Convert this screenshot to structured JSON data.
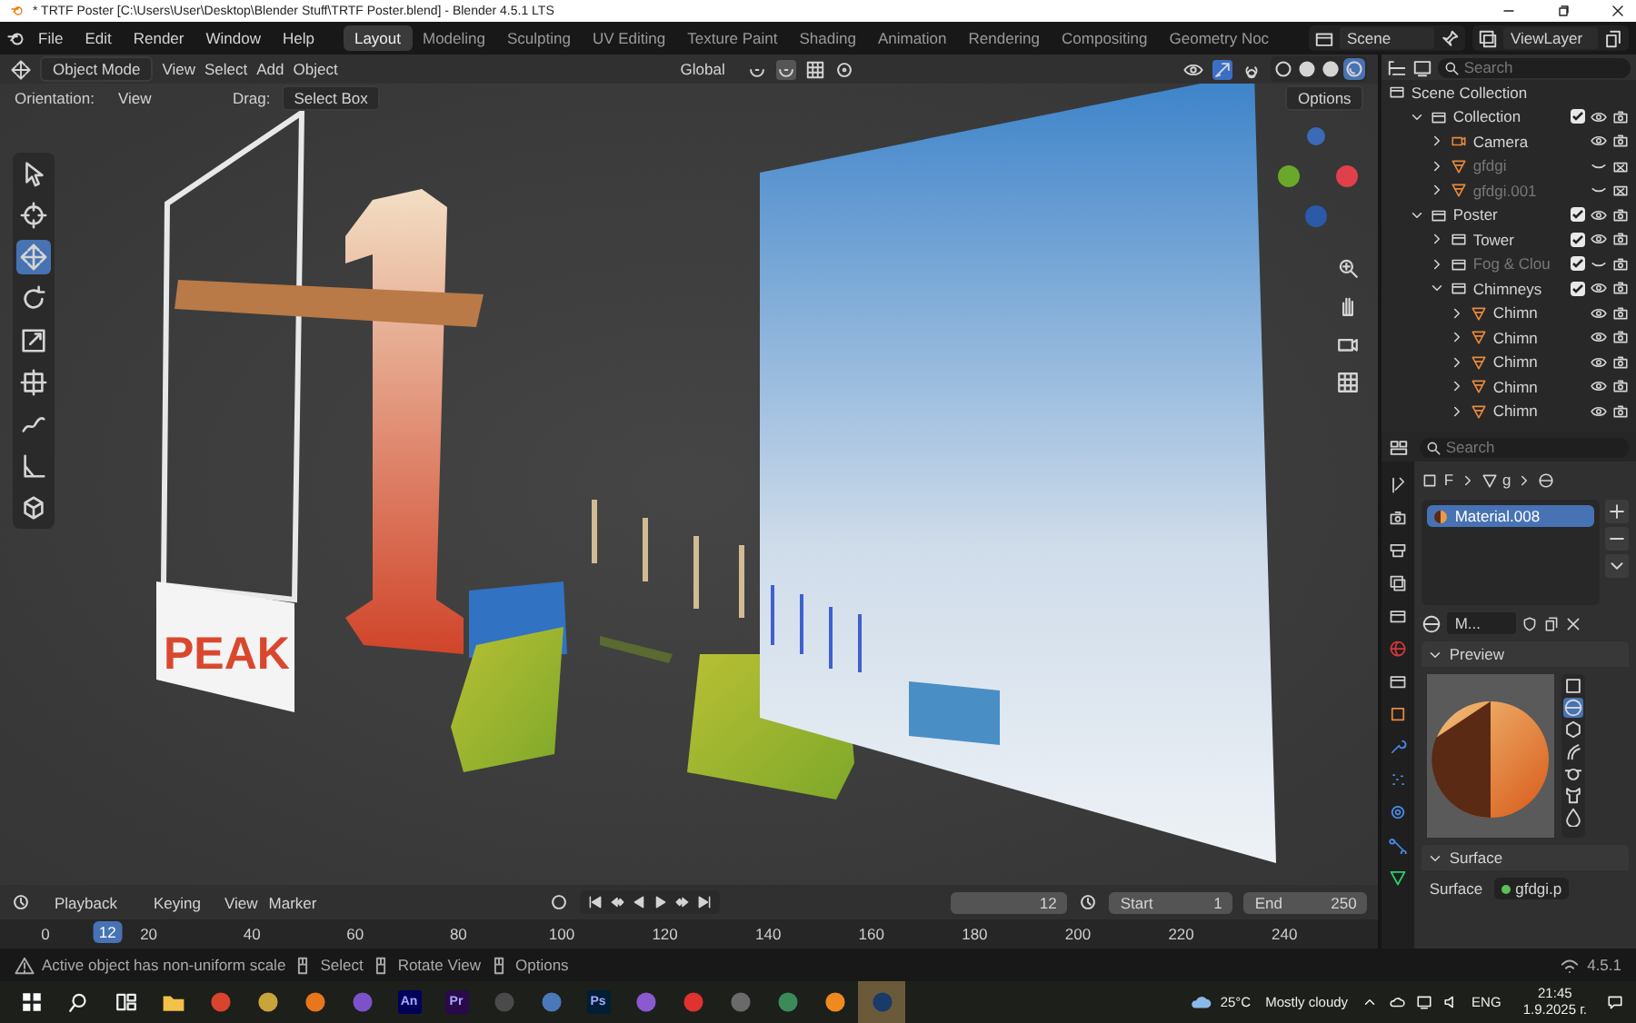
{
  "window": {
    "title": "* TRTF Poster [C:\\Users\\User\\Desktop\\Blender Stuff\\TRTF Poster.blend] - Blender 4.5.1 LTS"
  },
  "menu": [
    "File",
    "Edit",
    "Render",
    "Window",
    "Help"
  ],
  "workspaces": [
    {
      "label": "Layout",
      "selected": true
    },
    {
      "label": "Modeling",
      "selected": false
    },
    {
      "label": "Sculpting",
      "selected": false
    },
    {
      "label": "UV Editing",
      "selected": false
    },
    {
      "label": "Texture Paint",
      "selected": false
    },
    {
      "label": "Shading",
      "selected": false
    },
    {
      "label": "Animation",
      "selected": false
    },
    {
      "label": "Rendering",
      "selected": false
    },
    {
      "label": "Compositing",
      "selected": false
    },
    {
      "label": "Geometry Noc",
      "selected": false
    }
  ],
  "scene": {
    "name": "Scene"
  },
  "view_layer": {
    "name": "ViewLayer"
  },
  "viewport_header": {
    "mode": "Object Mode",
    "menus": [
      "View",
      "Select",
      "Add",
      "Object"
    ],
    "orientation": "Global",
    "shading": [
      {
        "kind": "wireframe",
        "selected": false
      },
      {
        "kind": "solid",
        "selected": false
      },
      {
        "kind": "material",
        "selected": false
      },
      {
        "kind": "rendered",
        "selected": true
      }
    ]
  },
  "tool_settings": {
    "orientation_label": "Orientation:",
    "orientation": "View",
    "drag_label": "Drag:",
    "drag": "Select Box",
    "options": "Options"
  },
  "tools": [
    {
      "kind": "select",
      "selected": false
    },
    {
      "kind": "cursor",
      "selected": false
    },
    {
      "kind": "move",
      "selected": true
    },
    {
      "kind": "rotate",
      "selected": false
    },
    {
      "kind": "scale",
      "selected": false
    },
    {
      "kind": "transform",
      "selected": false
    },
    {
      "kind": "annotate",
      "selected": false
    },
    {
      "kind": "measure",
      "selected": false
    },
    {
      "kind": "add-cube",
      "selected": false
    }
  ],
  "scene_view": {
    "poster_text": "PEAK"
  },
  "outliner": {
    "search_placeholder": "Search",
    "tree": {
      "name": "Scene Collection",
      "kind": "scene",
      "children": [
        {
          "name": "Collection",
          "kind": "collection",
          "expanded": true,
          "checked": true,
          "visible": true,
          "renderable": true,
          "disabled": false,
          "children": [
            {
              "name": "Camera",
              "kind": "camera",
              "expanded": false,
              "visible": true,
              "renderable": true,
              "disabled": false
            },
            {
              "name": "gfdgi",
              "kind": "mesh",
              "expanded": false,
              "visible": false,
              "renderable": false,
              "disabled": true
            },
            {
              "name": "gfdgi.001",
              "kind": "mesh",
              "expanded": false,
              "visible": false,
              "renderable": false,
              "disabled": true
            }
          ]
        },
        {
          "name": "Poster",
          "kind": "collection",
          "expanded": true,
          "checked": true,
          "visible": true,
          "renderable": true,
          "disabled": false,
          "children": [
            {
              "name": "Tower",
              "kind": "collection",
              "expanded": false,
              "checked": true,
              "visible": true,
              "renderable": true,
              "disabled": false
            },
            {
              "name": "Fog & Clou",
              "kind": "collection",
              "expanded": false,
              "checked": true,
              "visible": false,
              "renderable": true,
              "disabled": true
            },
            {
              "name": "Chimneys",
              "kind": "collection",
              "expanded": true,
              "checked": true,
              "visible": true,
              "renderable": true,
              "disabled": false,
              "children": [
                {
                  "name": "Chimn",
                  "kind": "mesh",
                  "expanded": false,
                  "visible": true,
                  "renderable": true,
                  "disabled": false
                },
                {
                  "name": "Chimn",
                  "kind": "mesh",
                  "expanded": false,
                  "visible": true,
                  "renderable": true,
                  "disabled": false
                },
                {
                  "name": "Chimn",
                  "kind": "mesh",
                  "expanded": false,
                  "visible": true,
                  "renderable": true,
                  "disabled": false
                },
                {
                  "name": "Chimn",
                  "kind": "mesh",
                  "expanded": false,
                  "visible": true,
                  "renderable": true,
                  "disabled": false
                },
                {
                  "name": "Chimn",
                  "kind": "mesh",
                  "expanded": false,
                  "visible": true,
                  "renderable": true,
                  "disabled": false
                }
              ]
            }
          ]
        }
      ]
    }
  },
  "properties": {
    "search_placeholder": "Search",
    "tabs": [
      {
        "kind": "tool"
      },
      {
        "kind": "render"
      },
      {
        "kind": "output"
      },
      {
        "kind": "view-layer"
      },
      {
        "kind": "scene"
      },
      {
        "kind": "world"
      },
      {
        "kind": "collection"
      },
      {
        "kind": "object"
      },
      {
        "kind": "modifier"
      },
      {
        "kind": "particles"
      },
      {
        "kind": "physics"
      },
      {
        "kind": "constraints"
      },
      {
        "kind": "data"
      }
    ],
    "breadcrumb": [
      "F",
      "g"
    ],
    "material_slots": [
      {
        "name": "Material.008",
        "selected": true
      }
    ],
    "material_name": "M...",
    "preview_title": "Preview",
    "preview_shapes": [
      {
        "kind": "plane",
        "selected": false
      },
      {
        "kind": "sphere",
        "selected": true
      },
      {
        "kind": "cube",
        "selected": false
      },
      {
        "kind": "hair",
        "selected": false
      },
      {
        "kind": "monkey",
        "selected": false
      },
      {
        "kind": "cloth",
        "selected": false
      },
      {
        "kind": "fluid",
        "selected": false
      }
    ],
    "surface_title": "Surface",
    "surface_label": "Surface",
    "surface_value": "gfdgi.p"
  },
  "timeline": {
    "menus": [
      "Playback",
      "Keying",
      "View",
      "Marker"
    ],
    "current_frame": "12",
    "start_label": "Start",
    "start": "1",
    "end_label": "End",
    "end": "250",
    "ticks": [
      "0",
      "20",
      "40",
      "60",
      "80",
      "100",
      "120",
      "140",
      "160",
      "180",
      "200",
      "220",
      "240"
    ],
    "playhead": "12"
  },
  "status_bar": {
    "warning": "Active object has non-uniform scale",
    "hints": [
      "Select",
      "Rotate View",
      "Options"
    ],
    "version": "4.5.1"
  },
  "taskbar": {
    "apps": [
      {
        "kind": "windows",
        "selected": false
      },
      {
        "kind": "search",
        "selected": false
      },
      {
        "kind": "task-view",
        "selected": false
      },
      {
        "kind": "folder",
        "selected": false
      },
      {
        "kind": "app",
        "color": "#d8442c",
        "selected": false
      },
      {
        "kind": "app",
        "color": "#c9a43a",
        "selected": false
      },
      {
        "kind": "app",
        "color": "#e8761c",
        "selected": false
      },
      {
        "kind": "app",
        "color": "#7d52c8",
        "selected": false
      },
      {
        "kind": "badge",
        "color": "#00005b",
        "label": "An",
        "selected": false
      },
      {
        "kind": "badge",
        "color": "#2a0a4a",
        "label": "Pr",
        "selected": false
      },
      {
        "kind": "app",
        "color": "#4a4a4a",
        "selected": false
      },
      {
        "kind": "app",
        "color": "#4a78b8",
        "selected": false
      },
      {
        "kind": "badge",
        "color": "#001e36",
        "label": "Ps",
        "selected": false
      },
      {
        "kind": "app",
        "color": "#8a5ad0",
        "selected": false
      },
      {
        "kind": "app",
        "color": "#e0322e",
        "selected": false
      },
      {
        "kind": "app",
        "color": "#6a6a6a",
        "selected": false
      },
      {
        "kind": "app",
        "color": "#3a8a5a",
        "selected": false
      },
      {
        "kind": "app",
        "color": "#f08a1e",
        "selected": false
      },
      {
        "kind": "app",
        "color": "#1a3a6a",
        "selected": true
      }
    ],
    "weather": "25°C",
    "weather_text": "Mostly cloudy",
    "language": "ENG",
    "time": "21:45",
    "date": "1.9.2025 г."
  }
}
